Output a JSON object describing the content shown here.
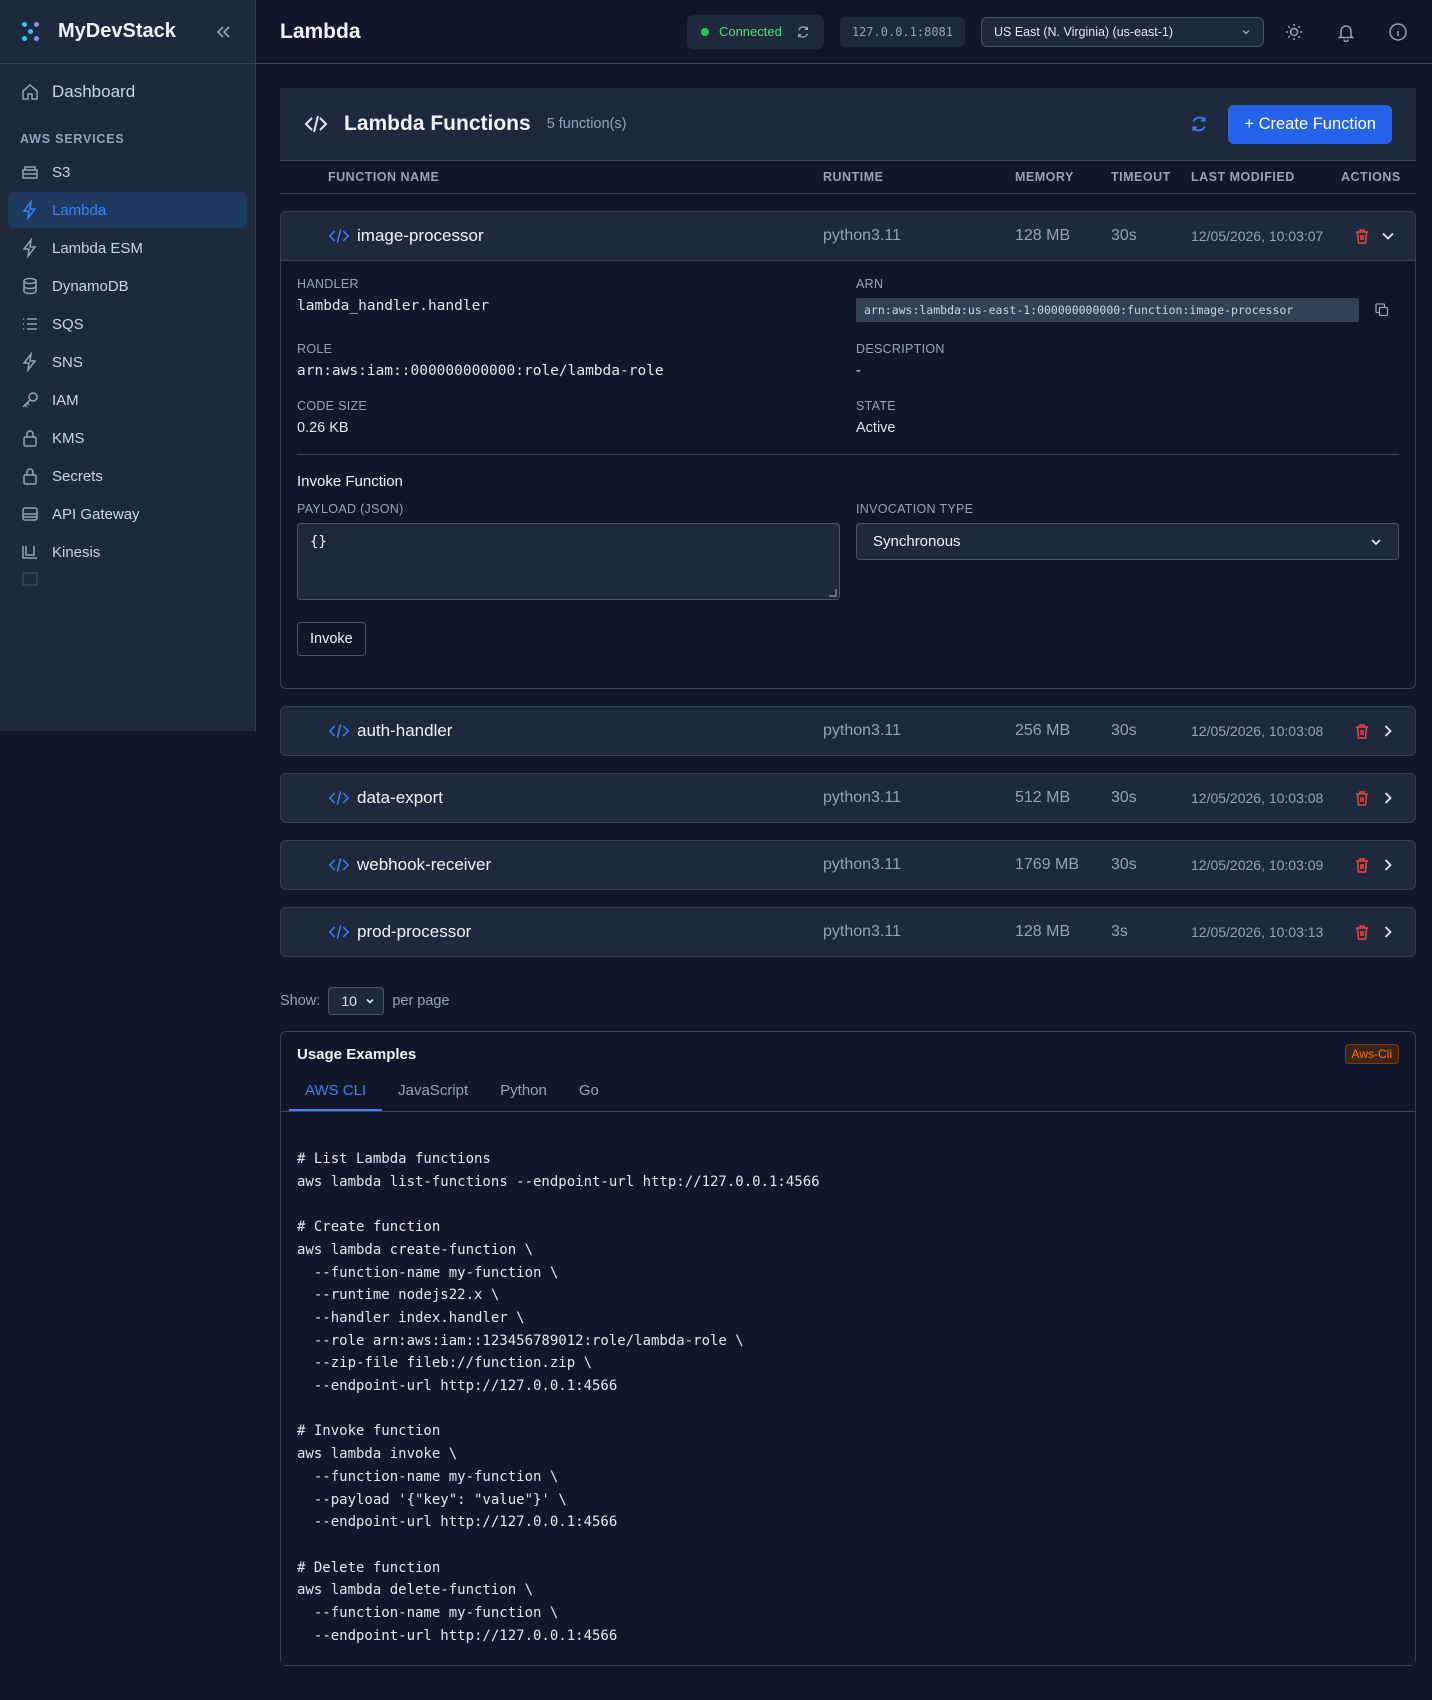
{
  "brand": {
    "name": "MyDevStack"
  },
  "sidebar": {
    "dashboard": "Dashboard",
    "section": "AWS SERVICES",
    "items": [
      {
        "label": "S3",
        "icon": "bucket-icon"
      },
      {
        "label": "Lambda",
        "icon": "bolt-icon",
        "active": true
      },
      {
        "label": "Lambda ESM",
        "icon": "bolt-icon"
      },
      {
        "label": "DynamoDB",
        "icon": "database-icon"
      },
      {
        "label": "SQS",
        "icon": "list-icon"
      },
      {
        "label": "SNS",
        "icon": "bolt-icon"
      },
      {
        "label": "IAM",
        "icon": "key-icon"
      },
      {
        "label": "KMS",
        "icon": "lock-icon"
      },
      {
        "label": "Secrets",
        "icon": "lock-icon"
      },
      {
        "label": "API Gateway",
        "icon": "server-icon"
      },
      {
        "label": "Kinesis",
        "icon": "stream-icon"
      }
    ]
  },
  "topbar": {
    "title": "Lambda",
    "status": "Connected",
    "endpoint": "127.0.0.1:8081",
    "region": "US East (N. Virginia) (us-east-1)"
  },
  "panel": {
    "title": "Lambda Functions",
    "count": "5 function(s)",
    "create_label": "+ Create Function",
    "columns": {
      "name": "FUNCTION NAME",
      "runtime": "RUNTIME",
      "memory": "MEMORY",
      "timeout": "TIMEOUT",
      "modified": "LAST MODIFIED",
      "actions": "ACTIONS"
    }
  },
  "functions": [
    {
      "name": "image-processor",
      "runtime": "python3.11",
      "memory": "128 MB",
      "timeout": "30s",
      "modified": "12/05/2026, 10:03:07"
    },
    {
      "name": "auth-handler",
      "runtime": "python3.11",
      "memory": "256 MB",
      "timeout": "30s",
      "modified": "12/05/2026, 10:03:08"
    },
    {
      "name": "data-export",
      "runtime": "python3.11",
      "memory": "512 MB",
      "timeout": "30s",
      "modified": "12/05/2026, 10:03:08"
    },
    {
      "name": "webhook-receiver",
      "runtime": "python3.11",
      "memory": "1769 MB",
      "timeout": "30s",
      "modified": "12/05/2026, 10:03:09"
    },
    {
      "name": "prod-processor",
      "runtime": "python3.11",
      "memory": "128 MB",
      "timeout": "3s",
      "modified": "12/05/2026, 10:03:13"
    }
  ],
  "detail": {
    "handler_label": "HANDLER",
    "handler": "lambda_handler.handler",
    "arn_label": "ARN",
    "arn": "arn:aws:lambda:us-east-1:000000000000:function:image-processor",
    "role_label": "ROLE",
    "role": "arn:aws:iam::000000000000:role/lambda-role",
    "description_label": "DESCRIPTION",
    "description": "-",
    "code_size_label": "CODE SIZE",
    "code_size": "0.26 KB",
    "state_label": "STATE",
    "state": "Active",
    "invoke_title": "Invoke Function",
    "payload_label": "PAYLOAD (JSON)",
    "payload": "{}",
    "invocation_label": "INVOCATION TYPE",
    "invocation_type": "Synchronous",
    "invoke_button": "Invoke"
  },
  "pager": {
    "show": "Show:",
    "value": "10",
    "per_page": "per page"
  },
  "usage": {
    "title": "Usage Examples",
    "badge": "Aws-Cli",
    "tabs": [
      "AWS CLI",
      "JavaScript",
      "Python",
      "Go"
    ],
    "code": "# List Lambda functions\naws lambda list-functions --endpoint-url http://127.0.0.1:4566\n\n# Create function\naws lambda create-function \\\n  --function-name my-function \\\n  --runtime nodejs22.x \\\n  --handler index.handler \\\n  --role arn:aws:iam::123456789012:role/lambda-role \\\n  --zip-file fileb://function.zip \\\n  --endpoint-url http://127.0.0.1:4566\n\n# Invoke function\naws lambda invoke \\\n  --function-name my-function \\\n  --payload '{\"key\": \"value\"}' \\\n  --endpoint-url http://127.0.0.1:4566\n\n# Delete function\naws lambda delete-function \\\n  --function-name my-function \\\n  --endpoint-url http://127.0.0.1:4566"
  },
  "colors": {
    "accent": "#3b82f6",
    "primary_button": "#2563eb",
    "danger": "#ef4444",
    "success": "#22c55e",
    "badge": "#f97316"
  }
}
